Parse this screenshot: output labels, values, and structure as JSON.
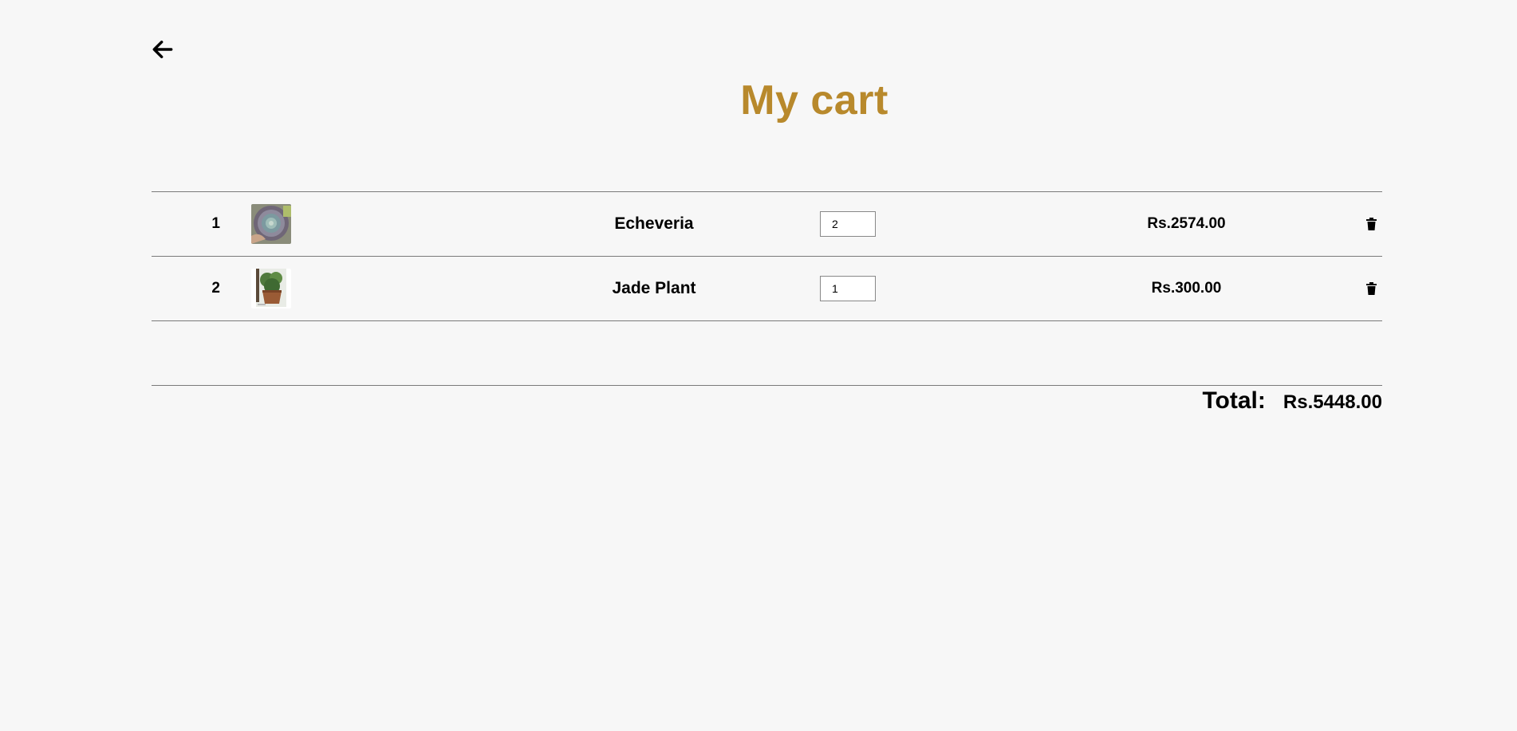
{
  "header": {
    "back_icon": "arrow-left-icon",
    "title": "My cart"
  },
  "cart": {
    "items": [
      {
        "index": "1",
        "name": "Echeveria",
        "quantity": "2",
        "price": "Rs.2574.00",
        "image": "echeveria-photo",
        "delete_icon": "trash-icon"
      },
      {
        "index": "2",
        "name": "Jade Plant",
        "quantity": "1",
        "price": "Rs.300.00",
        "image": "jade-plant-photo",
        "delete_icon": "trash-icon"
      }
    ]
  },
  "summary": {
    "total_label": "Total:",
    "total_value": "Rs.5448.00"
  },
  "colors": {
    "title": "#b8892c",
    "background": "#f7f7f7",
    "divider": "#7a7a7a"
  }
}
